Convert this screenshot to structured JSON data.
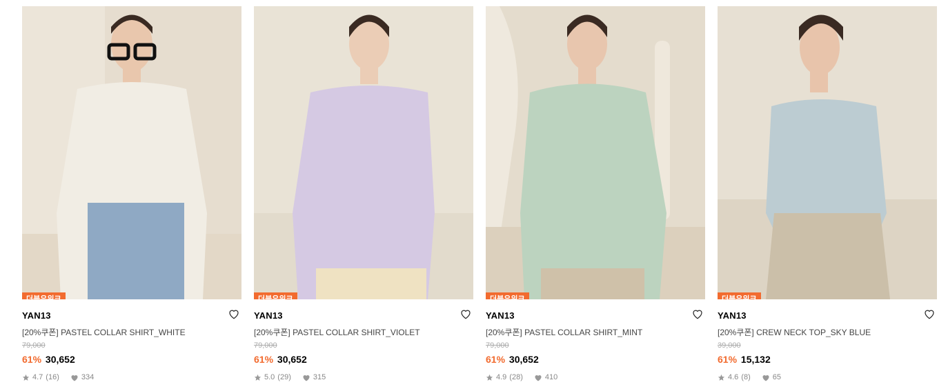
{
  "accent_color": "#f26b2f",
  "products": [
    {
      "badge": "더블유위크",
      "brand": "YAN13",
      "name": "[20%쿠폰] PASTEL COLLAR SHIRT_WHITE",
      "original_price": "79,000",
      "discount": "61%",
      "price": "30,652",
      "rating": "4.7",
      "reviews": "(16)",
      "likes": "334",
      "shirt_color": "#f1ede4"
    },
    {
      "badge": "더블유위크",
      "brand": "YAN13",
      "name": "[20%쿠폰] PASTEL COLLAR SHIRT_VIOLET",
      "original_price": "79,000",
      "discount": "61%",
      "price": "30,652",
      "rating": "5.0",
      "reviews": "(29)",
      "likes": "315",
      "shirt_color": "#d5c9e3"
    },
    {
      "badge": "더블유위크",
      "brand": "YAN13",
      "name": "[20%쿠폰] PASTEL COLLAR SHIRT_MINT",
      "original_price": "79,000",
      "discount": "61%",
      "price": "30,652",
      "rating": "4.9",
      "reviews": "(28)",
      "likes": "410",
      "shirt_color": "#bcd3bf"
    },
    {
      "badge": "더블유위크",
      "brand": "YAN13",
      "name": "[20%쿠폰] CREW NECK TOP_SKY BLUE",
      "original_price": "39,000",
      "discount": "61%",
      "price": "15,132",
      "rating": "4.6",
      "reviews": "(8)",
      "likes": "65",
      "shirt_color": "#bcccd2"
    }
  ]
}
